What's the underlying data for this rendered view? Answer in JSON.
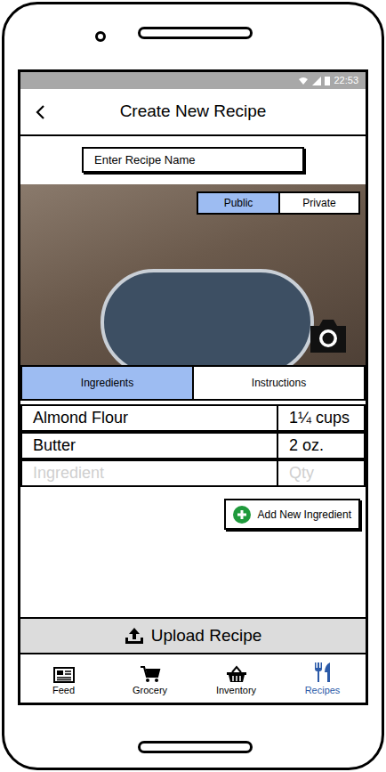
{
  "status_bar": {
    "time": "22:53"
  },
  "header": {
    "title": "Create New Recipe"
  },
  "recipe_name": {
    "placeholder": "Enter Recipe Name"
  },
  "visibility": [
    {
      "label": "Public",
      "selected": true
    },
    {
      "label": "Private",
      "selected": false
    }
  ],
  "tabs": [
    {
      "label": "Ingredients",
      "selected": true
    },
    {
      "label": "Instructions",
      "selected": false
    }
  ],
  "ingredients": [
    {
      "name": "Almond Flour",
      "qty": "1¼ cups"
    },
    {
      "name": "Butter",
      "qty": "2 oz."
    }
  ],
  "new_ingredient": {
    "name_placeholder": "Ingredient",
    "qty_placeholder": "Qty"
  },
  "add_button": "Add New Ingredient",
  "upload_button": "Upload Recipe",
  "nav": [
    {
      "label": "Feed",
      "selected": false
    },
    {
      "label": "Grocery",
      "selected": false
    },
    {
      "label": "Inventory",
      "selected": false
    },
    {
      "label": "Recipes",
      "selected": true
    }
  ]
}
